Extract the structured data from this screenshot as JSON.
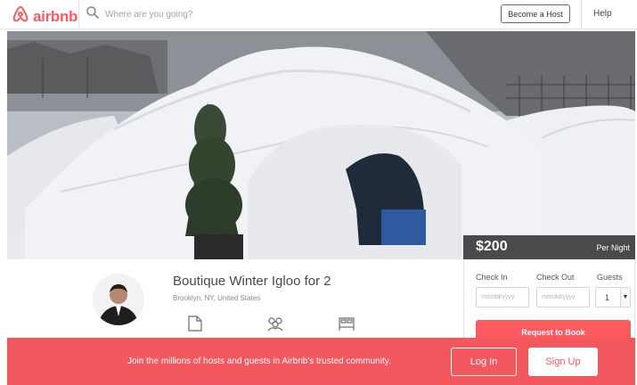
{
  "brand": {
    "name": "airbnb",
    "color": "#ff5a5f"
  },
  "search": {
    "placeholder": "Where are you going?"
  },
  "nav": {
    "become_host": "Become a Host",
    "help": "Help"
  },
  "listing": {
    "title": "Boutique Winter Igloo for 2",
    "location": "Brooklyn, NY, United States",
    "price": "$200",
    "per_night": "Per Night"
  },
  "booking": {
    "check_in_label": "Check In",
    "check_out_label": "Check Out",
    "guests_label": "Guests",
    "check_in_placeholder": "mm/dd/yyyy",
    "check_out_placeholder": "mm/dd/yyyy",
    "guests_value": "1",
    "request_label": "Request to Book"
  },
  "banner": {
    "text": "Join the millions of hosts and guests in Airbnb's trusted community.",
    "login": "Log In",
    "signup": "Sign Up"
  },
  "icons": {
    "logo": "airbnb-logo-icon",
    "search": "search-icon",
    "amenities": [
      "room-type-icon",
      "guests-icon",
      "bed-icon"
    ]
  }
}
